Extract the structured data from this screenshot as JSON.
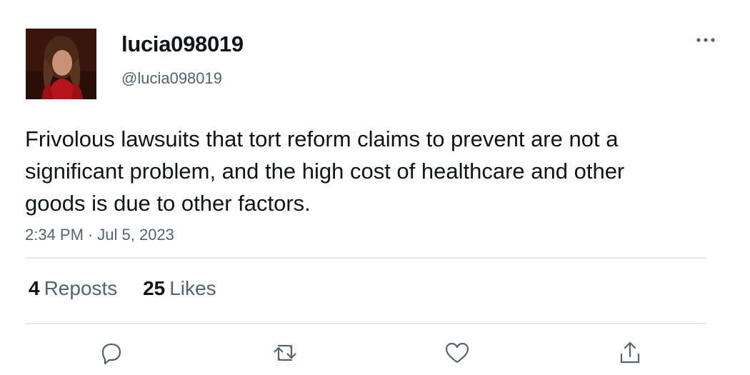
{
  "post": {
    "display_name": "lucia098019",
    "handle": "@lucia098019",
    "text": "Frivolous lawsuits that tort reform claims to prevent are not a significant problem, and the high cost of healthcare and other goods is due to other factors.",
    "time": "2:34 PM",
    "separator": "·",
    "date": "Jul 5, 2023"
  },
  "stats": {
    "reposts_count": "4",
    "reposts_label": "Reposts",
    "likes_count": "25",
    "likes_label": "Likes"
  },
  "icons": {
    "more": "more-horizontal-icon",
    "reply": "reply-icon",
    "repost": "repost-icon",
    "like": "heart-icon",
    "share": "share-icon"
  },
  "colors": {
    "text_primary": "#0f1419",
    "text_secondary": "#536471",
    "divider": "#e6e9eb",
    "icon": "#536471"
  }
}
